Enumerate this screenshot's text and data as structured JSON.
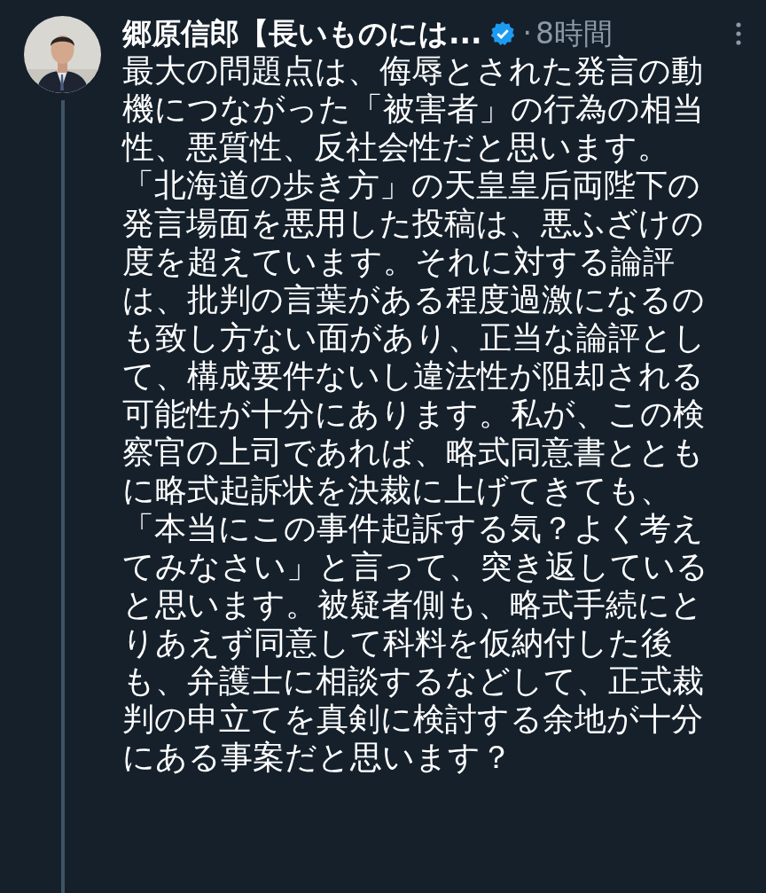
{
  "tweet": {
    "author": "郷原信郎【長いものには...",
    "verified": true,
    "separator": "·",
    "time": "8時間",
    "body": "最大の問題点は、侮辱とされた発言の動機につながった「被害者」の行為の相当性、悪質性、反社会性だと思います。「北海道の歩き方」の天皇皇后両陛下の発言場面を悪用した投稿は、悪ふざけの度を超えています。それに対する論評は、批判の言葉がある程度過激になるのも致し方ない面があり、正当な論評として、構成要件ないし違法性が阻却される可能性が十分にあります。私が、この検察官の上司であれば、略式同意書とともに略式起訴状を決裁に上げてきても、「本当にこの事件起訴する気？よく考えてみなさい」と言って、突き返していると思います。被疑者側も、略式手続にとりあえず同意して科料を仮納付した後も、弁護士に相談するなどして、正式裁判の申立てを真剣に検討する余地が十分にある事案だと思います？"
  }
}
